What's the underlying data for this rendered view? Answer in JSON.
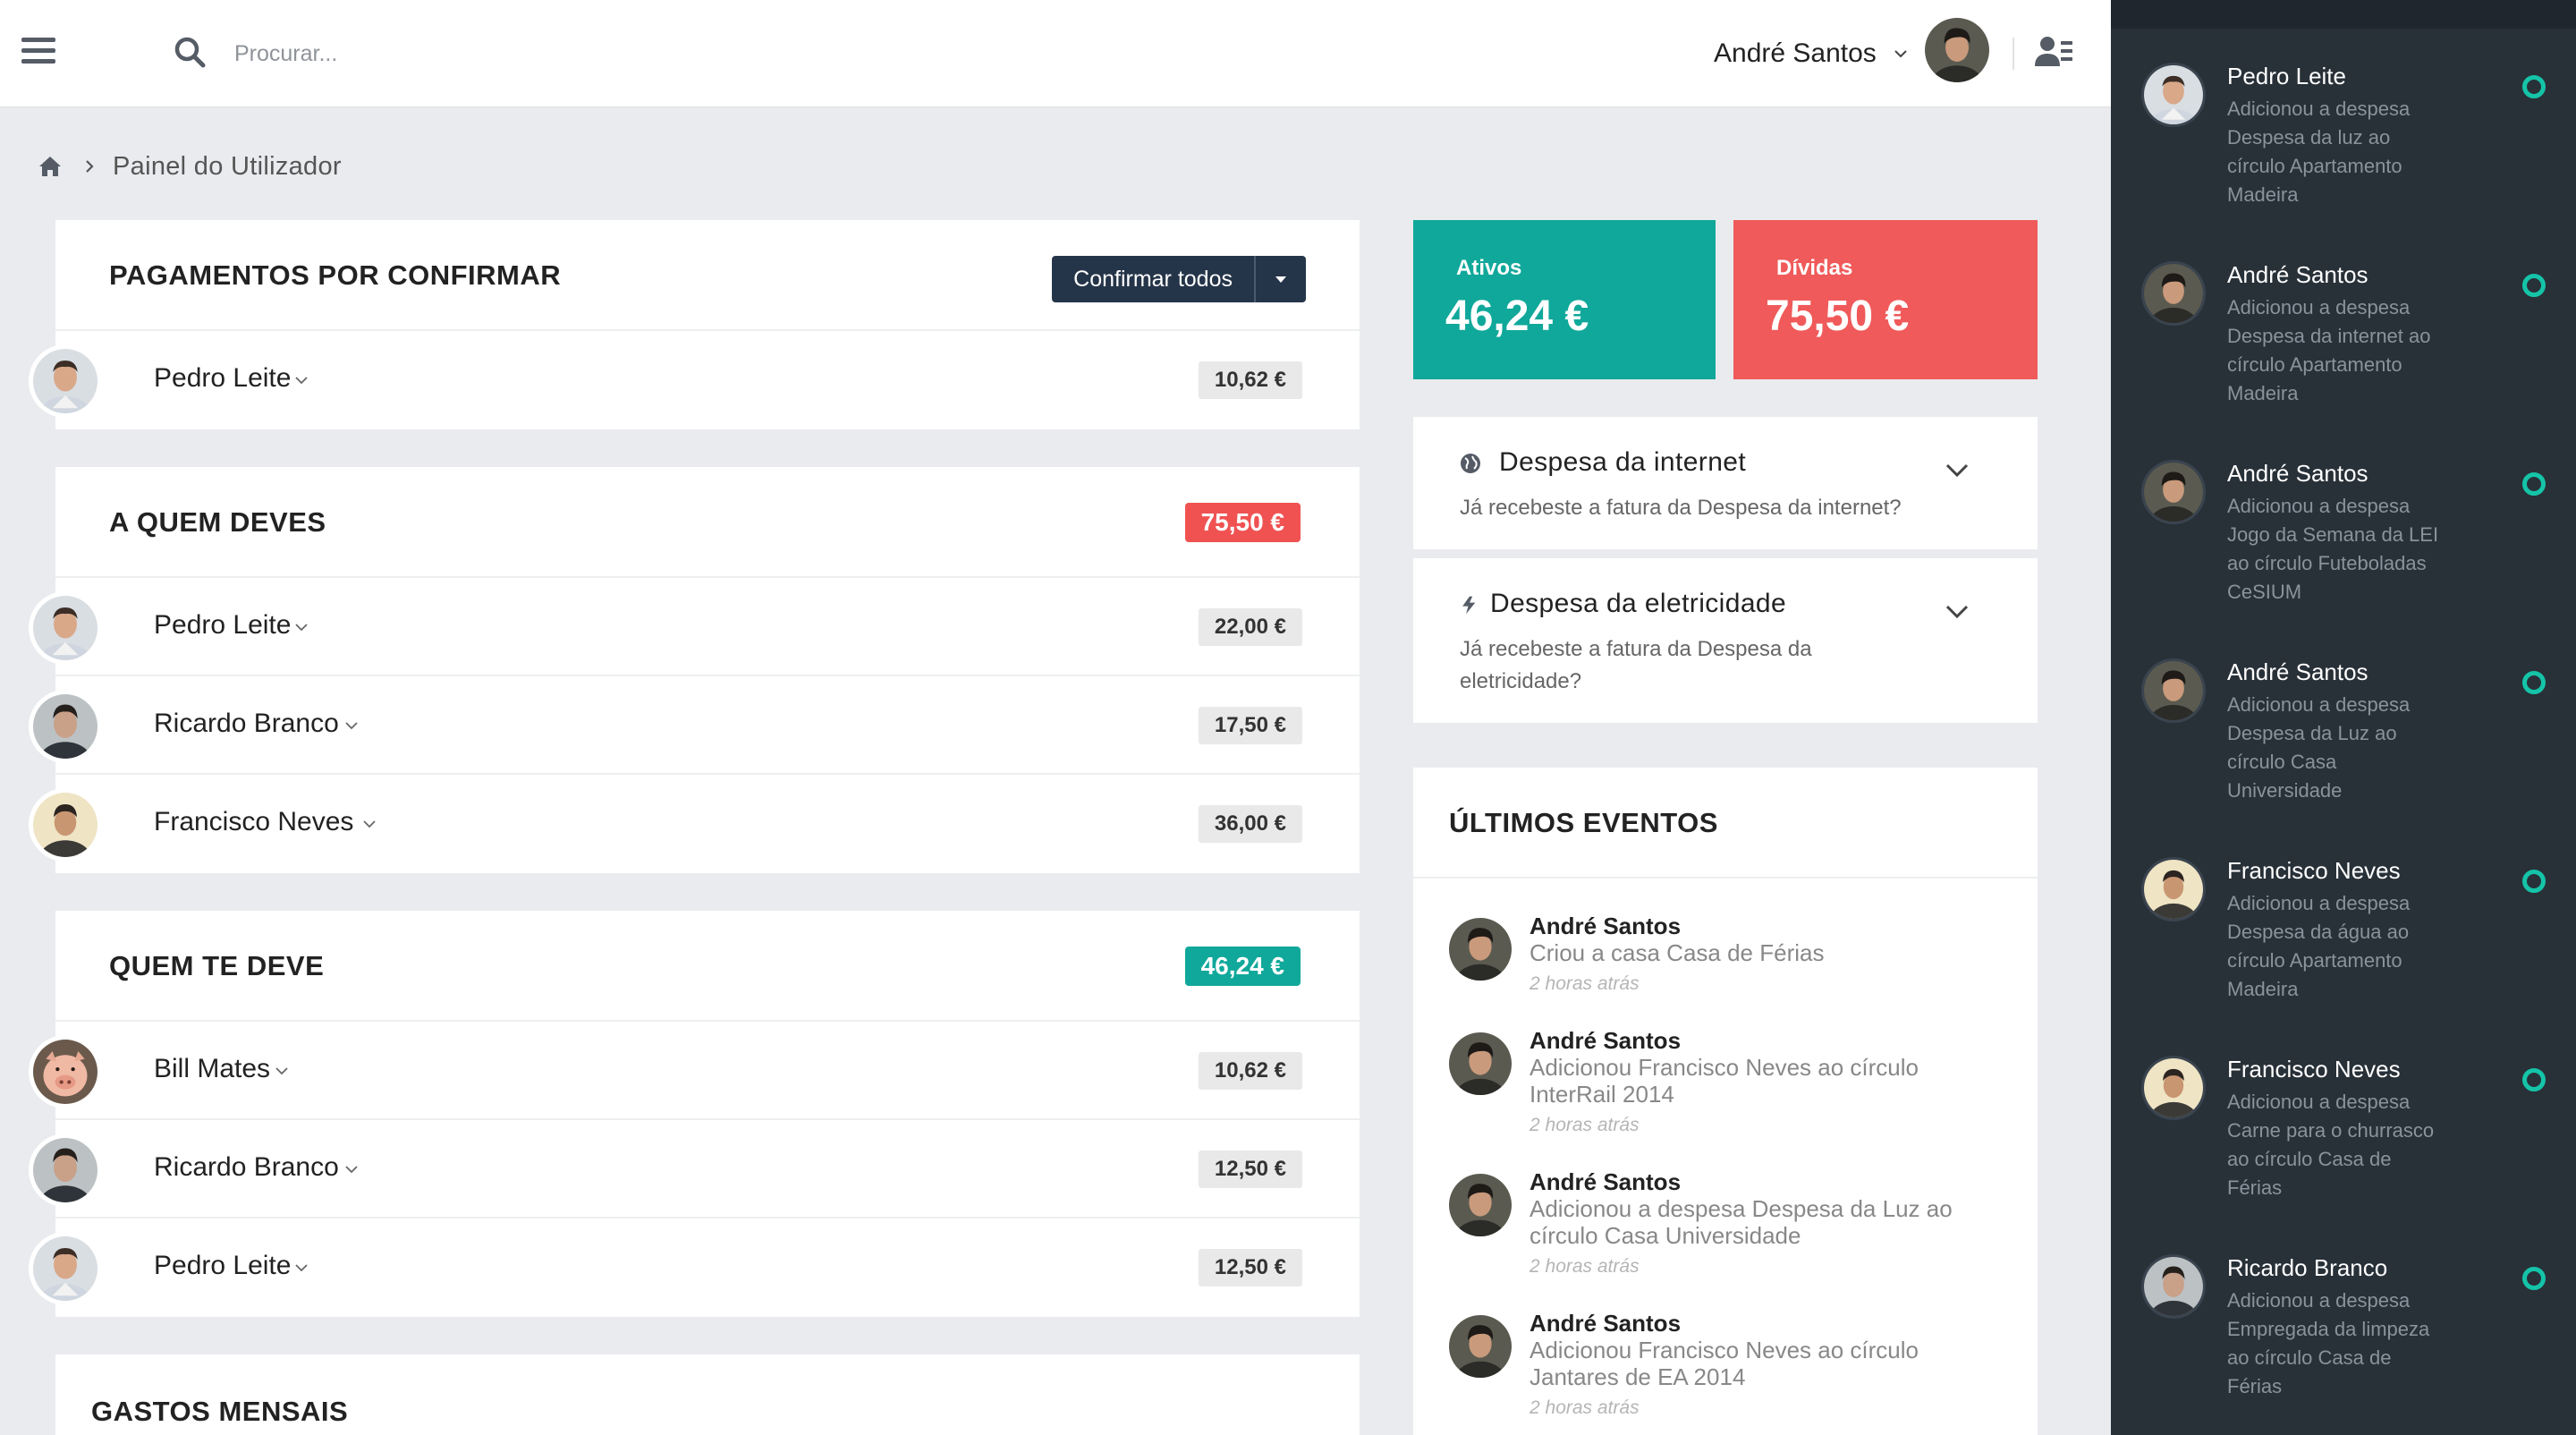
{
  "header": {
    "search_placeholder": "Procurar...",
    "user_name": "André Santos"
  },
  "breadcrumb": {
    "current": "Painel do Utilizador"
  },
  "pending": {
    "title": "PAGAMENTOS POR CONFIRMAR",
    "confirm_all_label": "Confirmar todos",
    "rows": [
      {
        "name": "Pedro Leite",
        "amount": "10,62 €"
      }
    ]
  },
  "owe": {
    "title": "A QUEM DEVES",
    "total": "75,50 €",
    "rows": [
      {
        "name": "Pedro Leite",
        "amount": "22,00 €"
      },
      {
        "name": "Ricardo Branco",
        "amount": "17,50 €"
      },
      {
        "name": "Francisco Neves",
        "amount": "36,00 €"
      }
    ]
  },
  "owed": {
    "title": "QUEM TE DEVE",
    "total": "46,24 €",
    "rows": [
      {
        "name": "Bill Mates",
        "amount": "10,62 €"
      },
      {
        "name": "Ricardo Branco",
        "amount": "12,50 €"
      },
      {
        "name": "Pedro Leite",
        "amount": "12,50 €"
      }
    ]
  },
  "monthly": {
    "title": "GASTOS MENSAIS"
  },
  "stats": {
    "assets_label": "Ativos",
    "assets_value": "46,24 €",
    "debts_label": "Dívidas",
    "debts_value": "75,50 €",
    "assets_color": "#10a89a",
    "debts_color": "#f05a5a"
  },
  "notices": [
    {
      "icon": "globe-icon",
      "title": "Despesa da internet",
      "desc": "Já recebeste a fatura da Despesa da internet?"
    },
    {
      "icon": "bolt-icon",
      "title": "Despesa da eletricidade",
      "desc": "Já recebeste a fatura da Despesa da eletricidade?"
    }
  ],
  "events": {
    "title": "ÚLTIMOS EVENTOS",
    "items": [
      {
        "name": "André Santos",
        "text": "Criou a casa Casa de Férias",
        "time": "2 horas atrás"
      },
      {
        "name": "André Santos",
        "text": "Adicionou Francisco Neves ao círculo InterRail 2014",
        "time": "2 horas atrás"
      },
      {
        "name": "André Santos",
        "text": "Adicionou a despesa Despesa da Luz ao círculo Casa Universidade",
        "time": "2 horas atrás"
      },
      {
        "name": "André Santos",
        "text": "Adicionou Francisco Neves ao círculo Jantares de EA 2014",
        "time": "2 horas atrás"
      }
    ]
  },
  "feed": [
    {
      "name": "Pedro Leite",
      "text": "Adicionou a despesa Despesa da luz ao círculo Apartamento Madeira"
    },
    {
      "name": "André Santos",
      "text": "Adicionou a despesa Despesa da internet ao círculo Apartamento Madeira"
    },
    {
      "name": "André Santos",
      "text": "Adicionou a despesa Jogo da Semana da LEI ao círculo Futeboladas CeSIUM"
    },
    {
      "name": "André Santos",
      "text": "Adicionou a despesa Despesa da Luz ao círculo Casa Universidade"
    },
    {
      "name": "Francisco Neves",
      "text": "Adicionou a despesa Despesa da água ao círculo Apartamento Madeira"
    },
    {
      "name": "Francisco Neves",
      "text": "Adicionou a despesa Carne para o churrasco ao círculo Casa de Férias"
    },
    {
      "name": "Ricardo Branco",
      "text": "Adicionou a despesa Empregada da limpeza ao círculo Casa de Férias"
    }
  ]
}
